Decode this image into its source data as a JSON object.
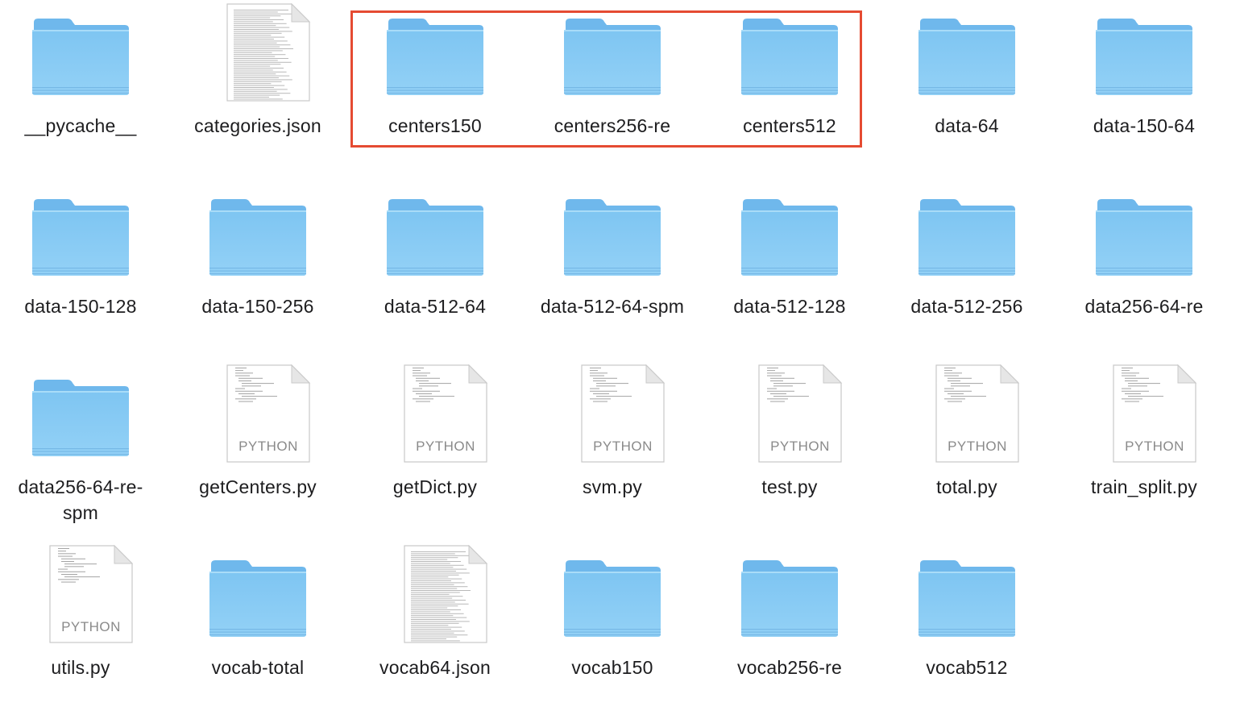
{
  "window": {
    "view": "icon-view"
  },
  "selection": {
    "color": "#e54b32",
    "items": [
      "centers150",
      "centers256-re",
      "centers512"
    ]
  },
  "colors": {
    "folder_body": "#8fcdf4",
    "folder_tab": "#78bff0",
    "label_text": "#1d1d1f"
  },
  "items": [
    {
      "name": "__pycache__",
      "kind": "folder"
    },
    {
      "name": "categories.json",
      "kind": "json"
    },
    {
      "name": "centers150",
      "kind": "folder"
    },
    {
      "name": "centers256-re",
      "kind": "folder"
    },
    {
      "name": "centers512",
      "kind": "folder"
    },
    {
      "name": "data-64",
      "kind": "folder"
    },
    {
      "name": "data-150-64",
      "kind": "folder"
    },
    {
      "name": "data-150-128",
      "kind": "folder"
    },
    {
      "name": "data-150-256",
      "kind": "folder"
    },
    {
      "name": "data-512-64",
      "kind": "folder"
    },
    {
      "name": "data-512-64-spm",
      "kind": "folder"
    },
    {
      "name": "data-512-128",
      "kind": "folder"
    },
    {
      "name": "data-512-256",
      "kind": "folder"
    },
    {
      "name": "data256-64-re",
      "kind": "folder"
    },
    {
      "name": "data256-64-re-spm",
      "kind": "folder"
    },
    {
      "name": "getCenters.py",
      "kind": "python",
      "badge": "PYTHON"
    },
    {
      "name": "getDict.py",
      "kind": "python",
      "badge": "PYTHON"
    },
    {
      "name": "svm.py",
      "kind": "python",
      "badge": "PYTHON"
    },
    {
      "name": "test.py",
      "kind": "python",
      "badge": "PYTHON"
    },
    {
      "name": "total.py",
      "kind": "python",
      "badge": "PYTHON"
    },
    {
      "name": "train_split.py",
      "kind": "python",
      "badge": "PYTHON"
    },
    {
      "name": "utils.py",
      "kind": "python",
      "badge": "PYTHON"
    },
    {
      "name": "vocab-total",
      "kind": "folder"
    },
    {
      "name": "vocab64.json",
      "kind": "json"
    },
    {
      "name": "vocab150",
      "kind": "folder"
    },
    {
      "name": "vocab256-re",
      "kind": "folder"
    },
    {
      "name": "vocab512",
      "kind": "folder"
    }
  ]
}
